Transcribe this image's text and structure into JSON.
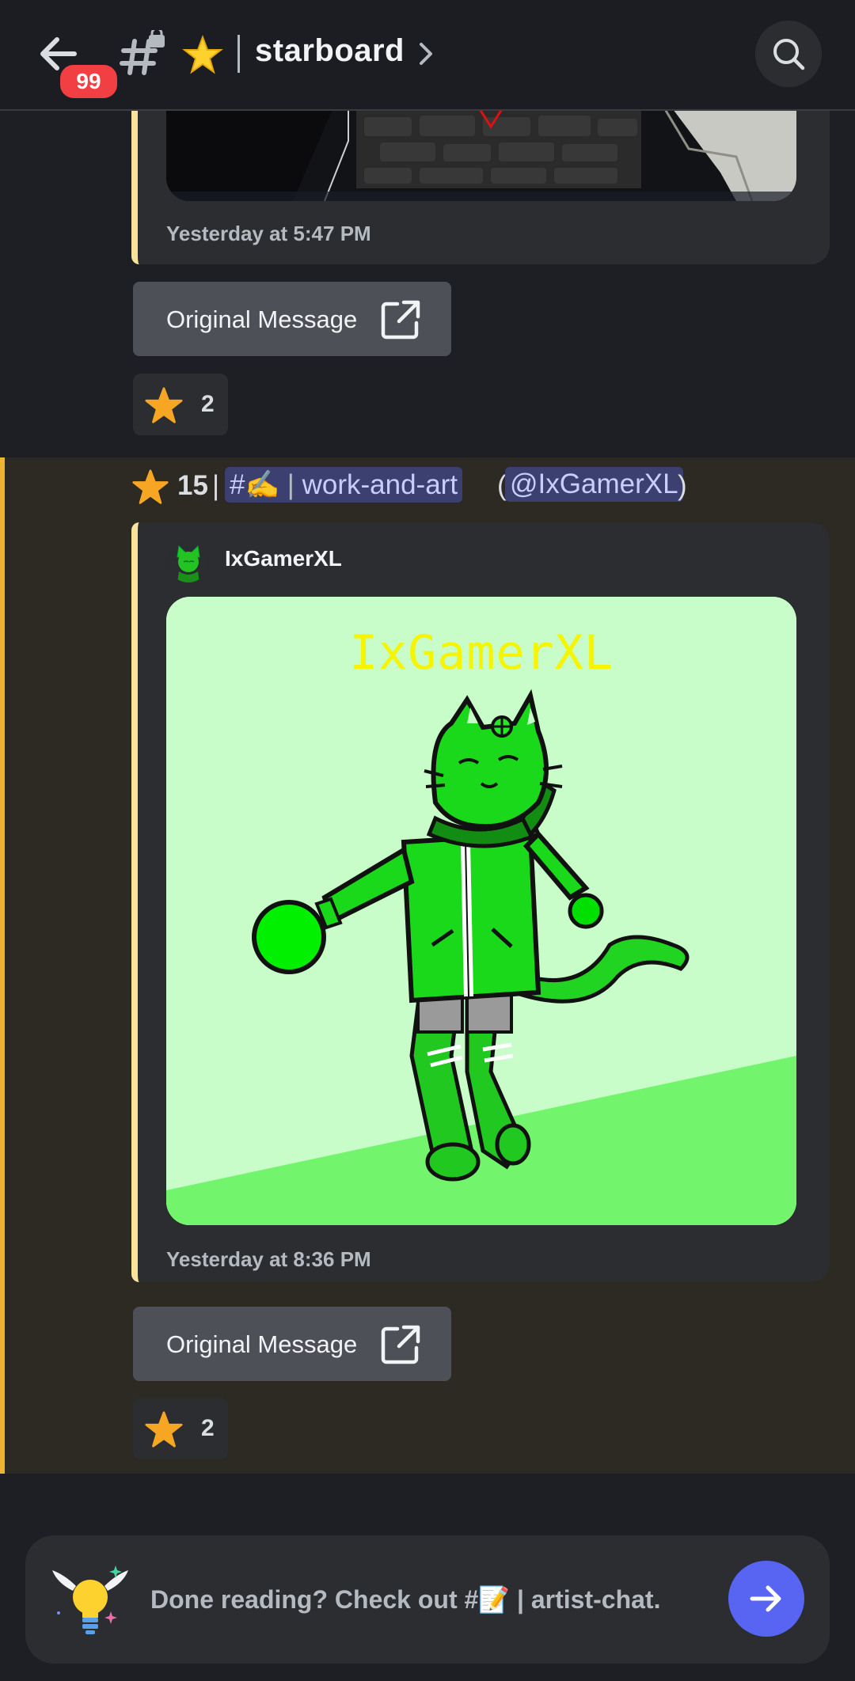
{
  "header": {
    "unread_badge": "99",
    "channel_name": "starboard",
    "channel_emoji": "star"
  },
  "messages": [
    {
      "timestamp": "Yesterday at 5:47 PM",
      "original_button": "Original Message",
      "reaction_count": "2"
    },
    {
      "star_count": "15",
      "separator": "|",
      "source_channel_prefix": "#✍️",
      "source_channel_name": "work-and-art",
      "open_paren": "(",
      "mention": "@IxGamerXL",
      "close_paren": ")",
      "author": "IxGamerXL",
      "art_text": "IxGamerXL",
      "timestamp": "Yesterday at 8:36 PM",
      "original_button": "Original Message",
      "reaction_count": "2"
    }
  ],
  "footer": {
    "prompt": "Done reading? Check out #📝 | artist-chat."
  },
  "colors": {
    "accent": "#5865f2",
    "badge": "#f23f43",
    "highlight_bar": "#f0b232",
    "embed_border": "#f7e49a"
  }
}
